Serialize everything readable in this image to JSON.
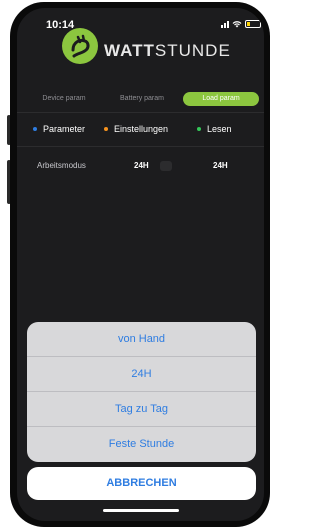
{
  "status_bar": {
    "time": "10:14"
  },
  "brand": {
    "prefix": "WATT",
    "suffix": "STUNDE"
  },
  "tabs": [
    {
      "label": "Device param",
      "active": false
    },
    {
      "label": "Battery param",
      "active": false
    },
    {
      "label": "Load param",
      "active": true
    }
  ],
  "legend": [
    {
      "label": "Parameter",
      "color": "#2f7de1"
    },
    {
      "label": "Einstellungen",
      "color": "#f7931e"
    },
    {
      "label": "Lesen",
      "color": "#34c759"
    }
  ],
  "row": {
    "label": "Arbeitsmodus",
    "setting": "24H",
    "reading": "24H"
  },
  "action_sheet": {
    "options": [
      "von Hand",
      "24H",
      "Tag zu Tag",
      "Feste Stunde"
    ],
    "cancel": "ABBRECHEN"
  },
  "colors": {
    "accent": "#8cc63f",
    "link": "#2f7de1"
  }
}
